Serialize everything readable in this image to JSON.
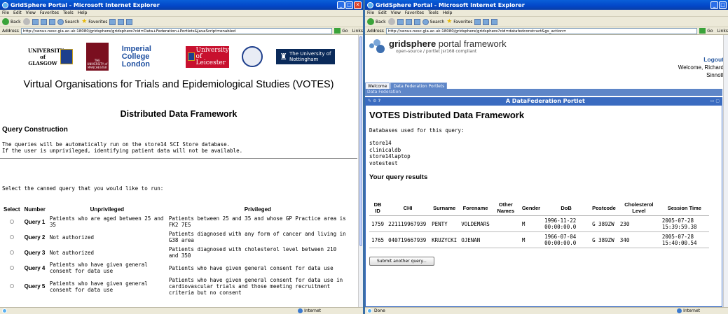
{
  "left_window": {
    "title": "GridSphere Portal - Microsoft Internet Explorer",
    "menu": [
      "File",
      "Edit",
      "View",
      "Favorites",
      "Tools",
      "Help"
    ],
    "toolbar": {
      "back": "Back",
      "search": "Search",
      "favorites": "Favorites"
    },
    "address_label": "Address",
    "url": "http://venus.nesc.gla.ac.uk:18080/gridsphere/gridsphere?cid=Data+Federation+Portlets&JavaScript=enabled",
    "go": "Go",
    "links": "Links",
    "status_zone": "Internet",
    "logos": {
      "glasgow": "UNIVERSITY of GLASGOW",
      "manchester": "THE UNIVERSITY of MANCHESTER",
      "imperial": "Imperial College London",
      "leicester": "University of Leicester",
      "nottingham": "The University of Nottingham"
    },
    "page_title": "Virtual Organisations for Trials and Epidemiological Studies (VOTES)",
    "section_title": "Distributed Data Framework",
    "query_construction": "Query Construction",
    "desc_line1": "The queries will be automatically run on the store14 SCI Store database.",
    "desc_line2": "If the user is unprivileged, identifying patient data will not be available.",
    "prompt": "Select the canned query that you would like to run:",
    "headers": {
      "select": "Select",
      "number": "Number",
      "unprivileged": "Unprivileged",
      "privileged": "Privileged"
    },
    "queries": [
      {
        "number": "Query 1",
        "unpriv": "Patients who are aged between 25 and 35",
        "priv": "Patients between 25 and 35 and whose GP Practice area is FK2 7ES"
      },
      {
        "number": "Query 2",
        "unpriv": "Not authorized",
        "priv": "Patients diagnosed with any form of cancer and living in G38 area"
      },
      {
        "number": "Query 3",
        "unpriv": "Not authorized",
        "priv": "Patients diagnosed with cholesterol level between 210 and 350"
      },
      {
        "number": "Query 4",
        "unpriv": "Patients who have given general consent for data use",
        "priv": "Patients who have given general consent for data use"
      },
      {
        "number": "Query 5",
        "unpriv": "Patients who have given general consent for data use",
        "priv": "Patients who have given general consent for data use in cardiovascular trials and those meeting recruitment criteria but no consent"
      }
    ]
  },
  "right_window": {
    "title": "GridSphere Portal - Microsoft Internet Explorer",
    "menu": [
      "File",
      "Edit",
      "View",
      "Favorites",
      "Tools",
      "Help"
    ],
    "toolbar": {
      "back": "Back",
      "search": "Search",
      "favorites": "Favorites"
    },
    "address_label": "Address",
    "url": "http://venus.nesc.gla.ac.uk:18080/gridsphere/gridsphere?cid=datafedconstruct&gs_action=",
    "go": "Go",
    "links": "Links",
    "status_left": "Done",
    "status_zone": "Internet",
    "gs_title_bold": "gridsphere",
    "gs_title_rest": " portal framework",
    "gs_sub": "open-source / portlet jsr168 compliant",
    "logout": "Logout",
    "welcome1": "Welcome, Richard",
    "welcome2": "Sinnott",
    "tabs": [
      "Welcome",
      "Data Federation Portlets"
    ],
    "subtab": "Data Federation",
    "portlet_title": "A DataFederation Portlet",
    "heading": "VOTES Distributed Data Framework",
    "db_label": "Databases used for this query:",
    "databases": [
      "store14",
      "clinicaldb",
      "store14laptop",
      "votestest"
    ],
    "results_label": "Your query results",
    "columns": [
      "DB ID",
      "CHI",
      "Surname",
      "Forename",
      "Other Names",
      "Gender",
      "DoB",
      "Postcode",
      "Cholesterol Level",
      "Session Time"
    ],
    "rows": [
      [
        "1759",
        "221119967939",
        "PENTY",
        "VOLDEMARS",
        "",
        "M",
        "1996-11-22 00:00:00.0",
        "G 389ZW",
        "230",
        "2005-07-28 15:39:59.38"
      ],
      [
        "1765",
        "040719667939",
        "KRUZYCKI",
        "OJENAN",
        "",
        "M",
        "1966-07-04 00:00:00.0",
        "G 389ZW",
        "340",
        "2005-07-28 15:40:00.54"
      ]
    ],
    "submit": "Submit another query..."
  }
}
